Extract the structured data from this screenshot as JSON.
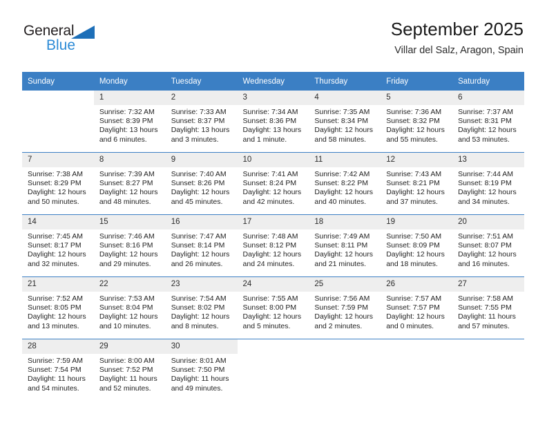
{
  "brand": {
    "name_dark": "General",
    "name_blue": "Blue",
    "accent_color": "#2b8ad6",
    "triangle_color": "#1d6fb8"
  },
  "header": {
    "title": "September 2025",
    "subtitle": "Villar del Salz, Aragon, Spain"
  },
  "calendar": {
    "header_color": "#3b7fc4",
    "daynum_band_color": "#eeeeee",
    "weekdays": [
      "Sunday",
      "Monday",
      "Tuesday",
      "Wednesday",
      "Thursday",
      "Friday",
      "Saturday"
    ],
    "labels": {
      "sunrise": "Sunrise:",
      "sunset": "Sunset:",
      "daylight": "Daylight:"
    },
    "weeks": [
      [
        {
          "day": ""
        },
        {
          "day": "1",
          "sunrise": "Sunrise: 7:32 AM",
          "sunset": "Sunset: 8:39 PM",
          "daylight": "Daylight: 13 hours and 6 minutes."
        },
        {
          "day": "2",
          "sunrise": "Sunrise: 7:33 AM",
          "sunset": "Sunset: 8:37 PM",
          "daylight": "Daylight: 13 hours and 3 minutes."
        },
        {
          "day": "3",
          "sunrise": "Sunrise: 7:34 AM",
          "sunset": "Sunset: 8:36 PM",
          "daylight": "Daylight: 13 hours and 1 minute."
        },
        {
          "day": "4",
          "sunrise": "Sunrise: 7:35 AM",
          "sunset": "Sunset: 8:34 PM",
          "daylight": "Daylight: 12 hours and 58 minutes."
        },
        {
          "day": "5",
          "sunrise": "Sunrise: 7:36 AM",
          "sunset": "Sunset: 8:32 PM",
          "daylight": "Daylight: 12 hours and 55 minutes."
        },
        {
          "day": "6",
          "sunrise": "Sunrise: 7:37 AM",
          "sunset": "Sunset: 8:31 PM",
          "daylight": "Daylight: 12 hours and 53 minutes."
        }
      ],
      [
        {
          "day": "7",
          "sunrise": "Sunrise: 7:38 AM",
          "sunset": "Sunset: 8:29 PM",
          "daylight": "Daylight: 12 hours and 50 minutes."
        },
        {
          "day": "8",
          "sunrise": "Sunrise: 7:39 AM",
          "sunset": "Sunset: 8:27 PM",
          "daylight": "Daylight: 12 hours and 48 minutes."
        },
        {
          "day": "9",
          "sunrise": "Sunrise: 7:40 AM",
          "sunset": "Sunset: 8:26 PM",
          "daylight": "Daylight: 12 hours and 45 minutes."
        },
        {
          "day": "10",
          "sunrise": "Sunrise: 7:41 AM",
          "sunset": "Sunset: 8:24 PM",
          "daylight": "Daylight: 12 hours and 42 minutes."
        },
        {
          "day": "11",
          "sunrise": "Sunrise: 7:42 AM",
          "sunset": "Sunset: 8:22 PM",
          "daylight": "Daylight: 12 hours and 40 minutes."
        },
        {
          "day": "12",
          "sunrise": "Sunrise: 7:43 AM",
          "sunset": "Sunset: 8:21 PM",
          "daylight": "Daylight: 12 hours and 37 minutes."
        },
        {
          "day": "13",
          "sunrise": "Sunrise: 7:44 AM",
          "sunset": "Sunset: 8:19 PM",
          "daylight": "Daylight: 12 hours and 34 minutes."
        }
      ],
      [
        {
          "day": "14",
          "sunrise": "Sunrise: 7:45 AM",
          "sunset": "Sunset: 8:17 PM",
          "daylight": "Daylight: 12 hours and 32 minutes."
        },
        {
          "day": "15",
          "sunrise": "Sunrise: 7:46 AM",
          "sunset": "Sunset: 8:16 PM",
          "daylight": "Daylight: 12 hours and 29 minutes."
        },
        {
          "day": "16",
          "sunrise": "Sunrise: 7:47 AM",
          "sunset": "Sunset: 8:14 PM",
          "daylight": "Daylight: 12 hours and 26 minutes."
        },
        {
          "day": "17",
          "sunrise": "Sunrise: 7:48 AM",
          "sunset": "Sunset: 8:12 PM",
          "daylight": "Daylight: 12 hours and 24 minutes."
        },
        {
          "day": "18",
          "sunrise": "Sunrise: 7:49 AM",
          "sunset": "Sunset: 8:11 PM",
          "daylight": "Daylight: 12 hours and 21 minutes."
        },
        {
          "day": "19",
          "sunrise": "Sunrise: 7:50 AM",
          "sunset": "Sunset: 8:09 PM",
          "daylight": "Daylight: 12 hours and 18 minutes."
        },
        {
          "day": "20",
          "sunrise": "Sunrise: 7:51 AM",
          "sunset": "Sunset: 8:07 PM",
          "daylight": "Daylight: 12 hours and 16 minutes."
        }
      ],
      [
        {
          "day": "21",
          "sunrise": "Sunrise: 7:52 AM",
          "sunset": "Sunset: 8:05 PM",
          "daylight": "Daylight: 12 hours and 13 minutes."
        },
        {
          "day": "22",
          "sunrise": "Sunrise: 7:53 AM",
          "sunset": "Sunset: 8:04 PM",
          "daylight": "Daylight: 12 hours and 10 minutes."
        },
        {
          "day": "23",
          "sunrise": "Sunrise: 7:54 AM",
          "sunset": "Sunset: 8:02 PM",
          "daylight": "Daylight: 12 hours and 8 minutes."
        },
        {
          "day": "24",
          "sunrise": "Sunrise: 7:55 AM",
          "sunset": "Sunset: 8:00 PM",
          "daylight": "Daylight: 12 hours and 5 minutes."
        },
        {
          "day": "25",
          "sunrise": "Sunrise: 7:56 AM",
          "sunset": "Sunset: 7:59 PM",
          "daylight": "Daylight: 12 hours and 2 minutes."
        },
        {
          "day": "26",
          "sunrise": "Sunrise: 7:57 AM",
          "sunset": "Sunset: 7:57 PM",
          "daylight": "Daylight: 12 hours and 0 minutes."
        },
        {
          "day": "27",
          "sunrise": "Sunrise: 7:58 AM",
          "sunset": "Sunset: 7:55 PM",
          "daylight": "Daylight: 11 hours and 57 minutes."
        }
      ],
      [
        {
          "day": "28",
          "sunrise": "Sunrise: 7:59 AM",
          "sunset": "Sunset: 7:54 PM",
          "daylight": "Daylight: 11 hours and 54 minutes."
        },
        {
          "day": "29",
          "sunrise": "Sunrise: 8:00 AM",
          "sunset": "Sunset: 7:52 PM",
          "daylight": "Daylight: 11 hours and 52 minutes."
        },
        {
          "day": "30",
          "sunrise": "Sunrise: 8:01 AM",
          "sunset": "Sunset: 7:50 PM",
          "daylight": "Daylight: 11 hours and 49 minutes."
        },
        {
          "day": ""
        },
        {
          "day": ""
        },
        {
          "day": ""
        },
        {
          "day": ""
        }
      ]
    ]
  }
}
